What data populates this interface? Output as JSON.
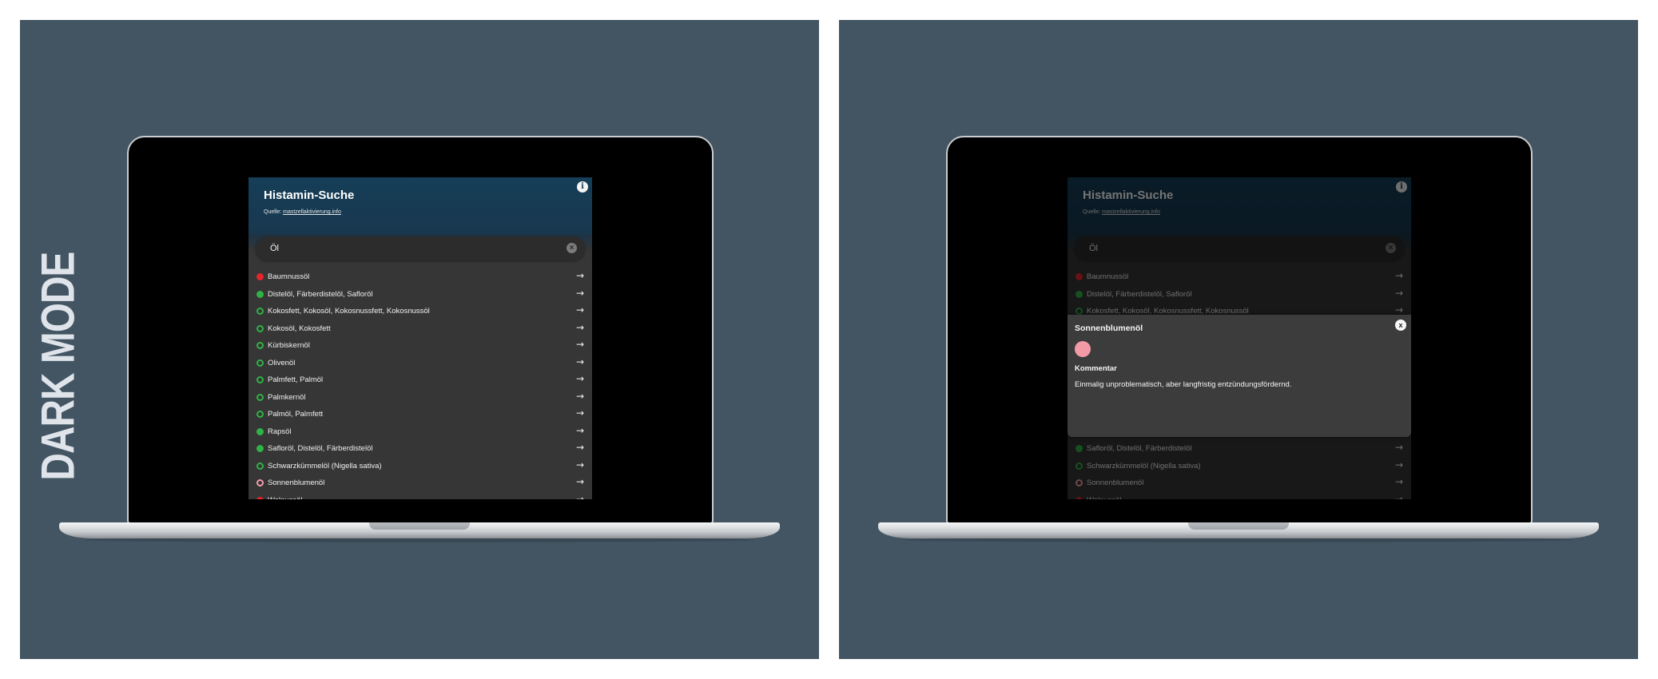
{
  "side_label": "DARK MODE",
  "app": {
    "title": "Histamin-Suche",
    "source_prefix": "Quelle: ",
    "source_link": "mastzellaktivierung.info",
    "info_icon": "info-icon",
    "search_value": "Öl",
    "clear_icon": "clear-x-icon",
    "arrow_glyph": "→"
  },
  "legend_colors": {
    "red": "#e4262c",
    "green": "#30b345",
    "pink": "#f2a0ac"
  },
  "items": [
    {
      "label": "Baumnussöl",
      "status": "filled-red"
    },
    {
      "label": "Distelöl, Färberdistelöl, Safloröl",
      "status": "filled-green"
    },
    {
      "label": "Kokosfett, Kokosöl, Kokosnussfett, Kokosnussöl",
      "status": "ring-green"
    },
    {
      "label": "Kokosöl, Kokosfett",
      "status": "ring-green"
    },
    {
      "label": "Kürbiskernöl",
      "status": "ring-green"
    },
    {
      "label": "Olivenöl",
      "status": "ring-green"
    },
    {
      "label": "Palmfett, Palmöl",
      "status": "ring-green"
    },
    {
      "label": "Palmkernöl",
      "status": "ring-green"
    },
    {
      "label": "Palmöl, Palmfett",
      "status": "ring-green"
    },
    {
      "label": "Rapsöl",
      "status": "filled-green"
    },
    {
      "label": "Safloröl, Distelöl, Färberdistelöl",
      "status": "filled-green"
    },
    {
      "label": "Schwarzkümmelöl (Nigella sativa)",
      "status": "ring-green"
    },
    {
      "label": "Sonnenblumenöl",
      "status": "ring-pink"
    },
    {
      "label": "Walnussöl",
      "status": "filled-red"
    }
  ],
  "modal": {
    "title": "Sonnenblumenöl",
    "close_label": "x",
    "subhead": "Kommentar",
    "text": "Einmalig unproblematisch, aber langfristig entzündungsfördernd."
  }
}
